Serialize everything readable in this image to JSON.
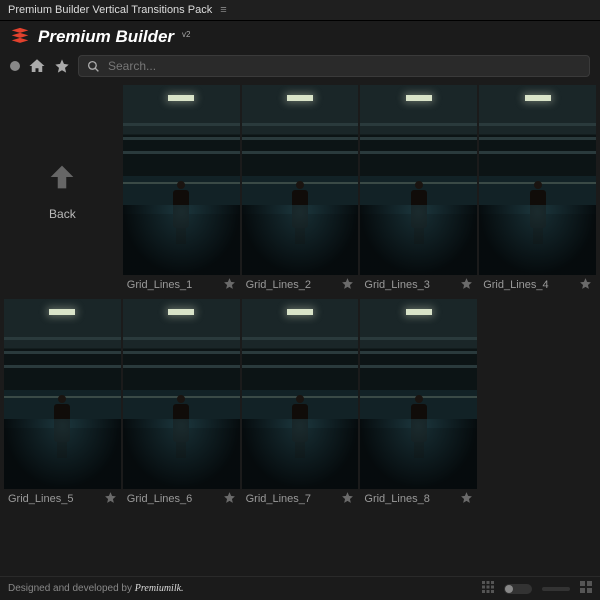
{
  "titlebar": {
    "title": "Premium Builder Vertical Transitions Pack"
  },
  "brand": {
    "name": "Premium Builder",
    "version": "v2"
  },
  "search": {
    "placeholder": "Search..."
  },
  "back": {
    "label": "Back"
  },
  "items": [
    {
      "name": "Grid_Lines_1"
    },
    {
      "name": "Grid_Lines_2"
    },
    {
      "name": "Grid_Lines_3"
    },
    {
      "name": "Grid_Lines_4"
    },
    {
      "name": "Grid_Lines_5"
    },
    {
      "name": "Grid_Lines_6"
    },
    {
      "name": "Grid_Lines_7"
    },
    {
      "name": "Grid_Lines_8"
    }
  ],
  "footer": {
    "credit_prefix": "Designed and developed by ",
    "credit_brand": "Premiumilk."
  }
}
